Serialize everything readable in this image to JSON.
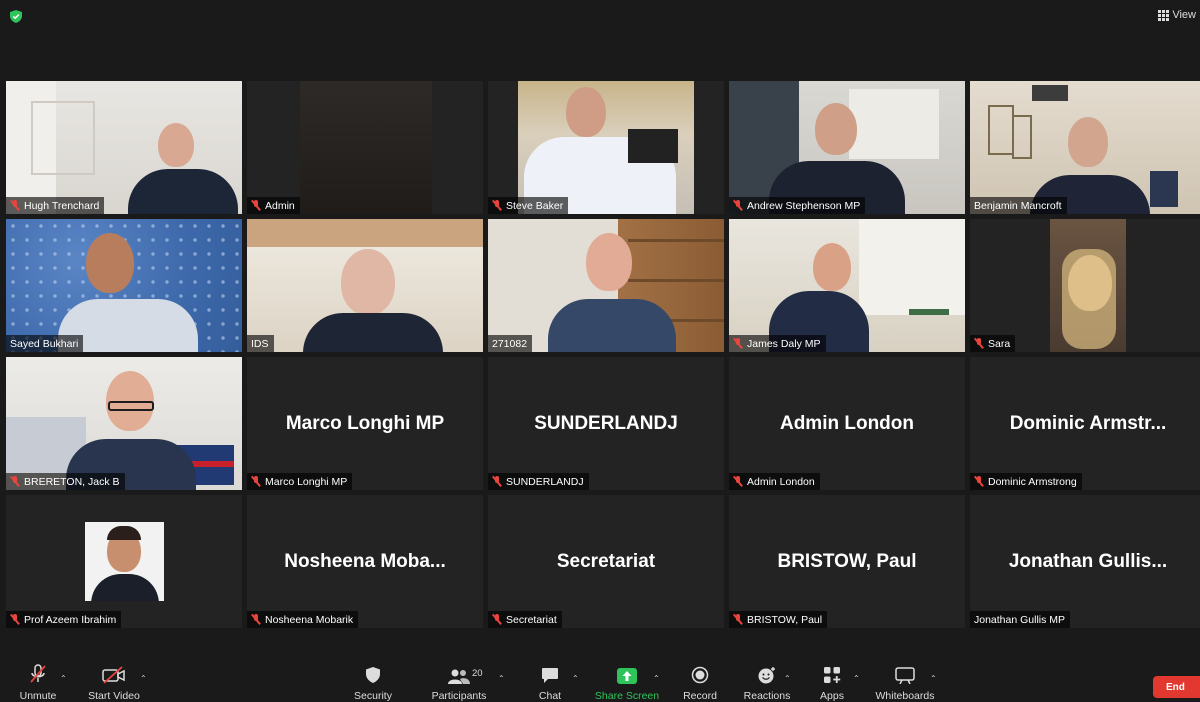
{
  "top_bar": {
    "view_label": "View"
  },
  "participants": [
    {
      "id": "hugh",
      "tag": "Hugh Trenchard",
      "muted": true
    },
    {
      "id": "admin",
      "tag": "Admin",
      "muted": true
    },
    {
      "id": "steve",
      "tag": "Steve Baker",
      "muted": true
    },
    {
      "id": "andrew",
      "tag": "Andrew Stephenson MP",
      "muted": true
    },
    {
      "id": "benjamin",
      "tag": "Benjamin Mancroft",
      "muted": false
    },
    {
      "id": "sayed",
      "tag": "Sayed Bukhari",
      "muted": false
    },
    {
      "id": "ids",
      "tag": "IDS",
      "muted": false
    },
    {
      "id": "n271082",
      "tag": "271082",
      "muted": false,
      "active_speaker": true
    },
    {
      "id": "james",
      "tag": "James Daly MP",
      "muted": true
    },
    {
      "id": "sara",
      "tag": "Sara",
      "muted": true
    },
    {
      "id": "brereton",
      "tag": "BRERETON, Jack B",
      "muted": true
    },
    {
      "id": "marco",
      "tag": "Marco Longhi MP",
      "display": "Marco Longhi MP",
      "muted": true
    },
    {
      "id": "sunderland",
      "tag": "SUNDERLANDJ",
      "display": "SUNDERLANDJ",
      "muted": true
    },
    {
      "id": "adminlondon",
      "tag": "Admin London",
      "display": "Admin London",
      "muted": true
    },
    {
      "id": "dominic",
      "tag": "Dominic Armstrong",
      "display": "Dominic  Armstr...",
      "muted": true
    },
    {
      "id": "azeem",
      "tag": "Prof Azeem Ibrahim",
      "muted": true
    },
    {
      "id": "nosheena",
      "tag": "Nosheena Mobarik",
      "display": "Nosheena  Moba...",
      "muted": true
    },
    {
      "id": "secretariat",
      "tag": "Secretariat",
      "display": "Secretariat",
      "muted": true
    },
    {
      "id": "bristow",
      "tag": "BRISTOW, Paul",
      "display": "BRISTOW,  Paul",
      "muted": true
    },
    {
      "id": "jonathan",
      "tag": "Jonathan Gullis MP",
      "display": "Jonathan  Gullis...",
      "muted": false
    }
  ],
  "toolbar": {
    "unmute": "Unmute",
    "start_video": "Start Video",
    "security": "Security",
    "participants": "Participants",
    "participant_count": "20",
    "chat": "Chat",
    "share_screen": "Share Screen",
    "record": "Record",
    "reactions": "Reactions",
    "apps": "Apps",
    "whiteboards": "Whiteboards",
    "end": "End"
  },
  "colors": {
    "active_speaker_border": "#d7e46a",
    "share_green": "#2ec45a",
    "end_red": "#e2382f",
    "muted_red": "#e8453c"
  }
}
